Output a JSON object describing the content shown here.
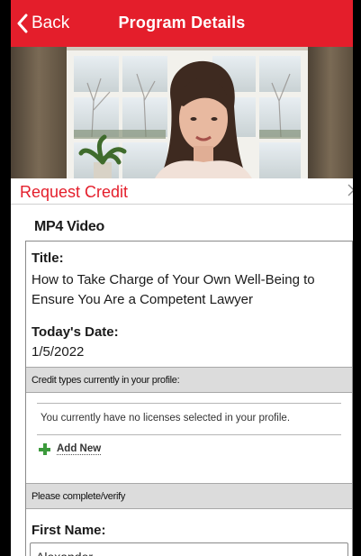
{
  "navbar": {
    "back_label": "Back",
    "title": "Program Details",
    "color": "#e41e2b"
  },
  "modal": {
    "title": "Request Credit",
    "close_icon": "close-icon",
    "video_type": "MP4 Video"
  },
  "program": {
    "title_label": "Title:",
    "title_value": "How to Take Charge of Your Own Well-Being to Ensure You Are a Competent Lawyer",
    "date_label": "Today's Date:",
    "date_value": "1/5/2022"
  },
  "credit_types": {
    "header": "Credit types currently in your profile:",
    "empty_message": "You currently have no licenses selected in your profile.",
    "add_new_label": "Add New",
    "add_icon": "plus-icon"
  },
  "verify": {
    "header": "Please complete/verify",
    "first_name_label": "First Name:",
    "first_name_value": "Alexander"
  }
}
